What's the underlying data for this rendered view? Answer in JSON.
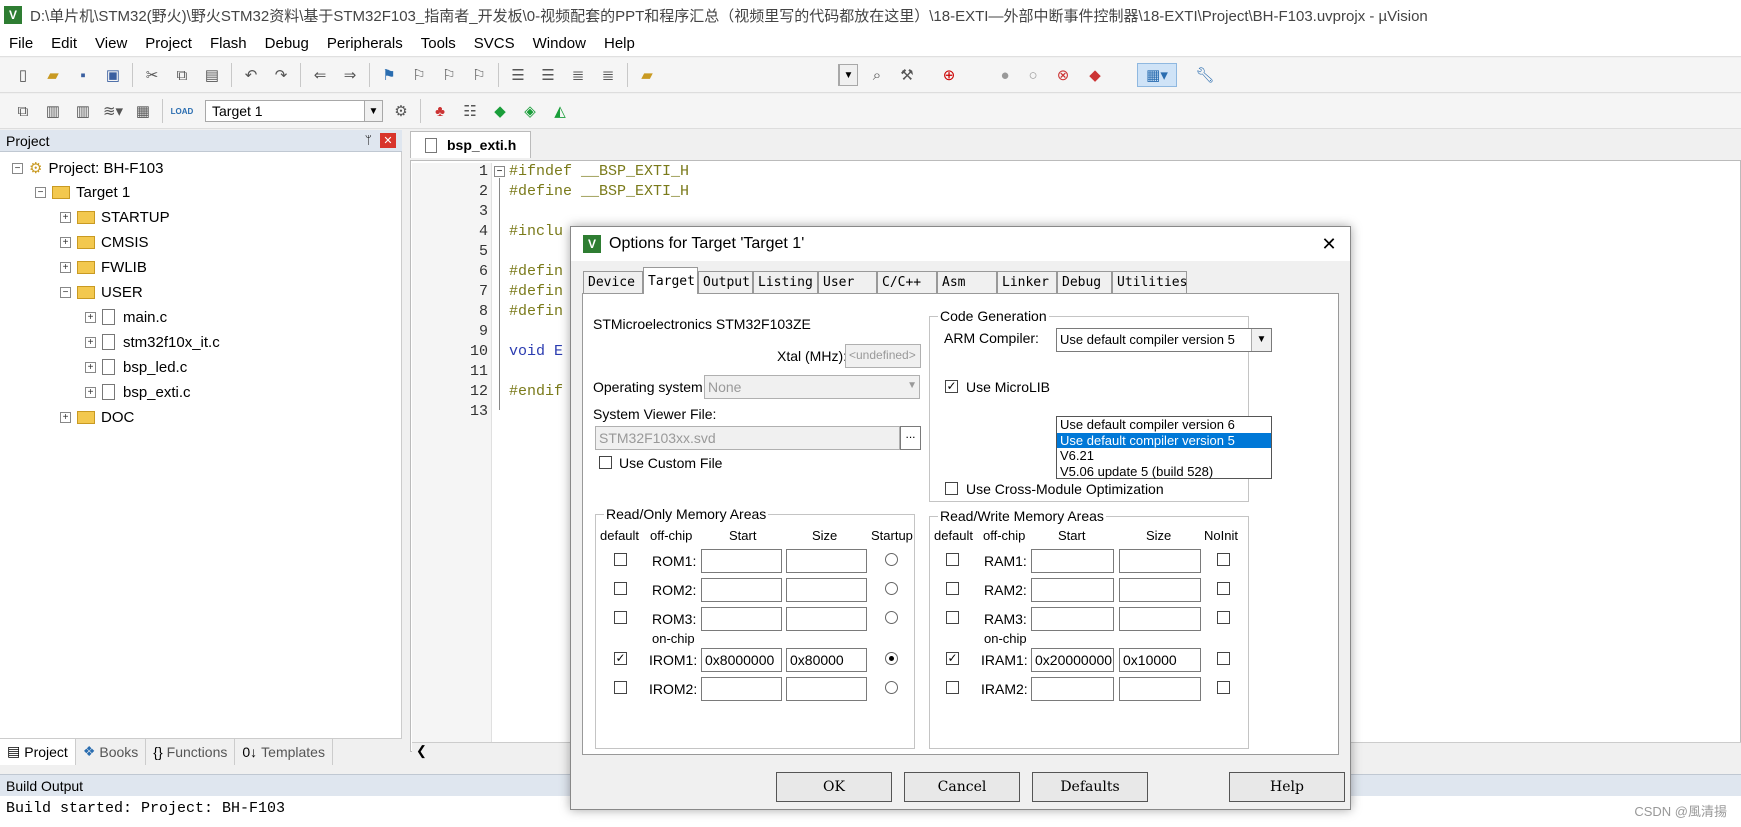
{
  "window": {
    "title": "D:\\单片机\\STM32(野火)\\野火STM32资料\\基于STM32F103_指南者_开发板\\0-视频配套的PPT和程序汇总（视频里写的代码都放在这里）\\18-EXTI—外部中断事件控制器\\18-EXTI\\Project\\BH-F103.uvprojx - µVision",
    "icon_letter": "V"
  },
  "menu": [
    "File",
    "Edit",
    "View",
    "Project",
    "Flash",
    "Debug",
    "Peripherals",
    "Tools",
    "SVCS",
    "Window",
    "Help"
  ],
  "toolbar2": {
    "target_combo": "Target 1",
    "load_icon_text": "LOAD"
  },
  "project_panel": {
    "header": "Project",
    "pin": "ᛘ",
    "close": "✕",
    "root": "Project: BH-F103",
    "target": "Target 1",
    "groups": [
      "STARTUP",
      "CMSIS",
      "FWLIB",
      "USER",
      "DOC"
    ],
    "user_files": [
      "main.c",
      "stm32f10x_it.c",
      "bsp_led.c",
      "bsp_exti.c"
    ],
    "tabs": [
      "Project",
      "Books",
      "Functions",
      "Templates"
    ]
  },
  "editor": {
    "tab": "bsp_exti.h",
    "lines": [
      {
        "n": "1",
        "t": "#ifndef __BSP_EXTI_H"
      },
      {
        "n": "2",
        "t": "#define __BSP_EXTI_H"
      },
      {
        "n": "3",
        "t": ""
      },
      {
        "n": "4",
        "t": "#inclu"
      },
      {
        "n": "5",
        "t": ""
      },
      {
        "n": "6",
        "t": "#defin"
      },
      {
        "n": "7",
        "t": "#defin"
      },
      {
        "n": "8",
        "t": "#defin"
      },
      {
        "n": "9",
        "t": ""
      },
      {
        "n": "10",
        "t": "void E"
      },
      {
        "n": "11",
        "t": ""
      },
      {
        "n": "12",
        "t": "#endif"
      },
      {
        "n": "13",
        "t": ""
      }
    ]
  },
  "build_output": {
    "header": "Build Output",
    "line": "Build started: Project: BH-F103"
  },
  "watermark": "CSDN @風清揚",
  "dialog": {
    "title": "Options for Target 'Target 1'",
    "close": "✕",
    "tabs": [
      "Device",
      "Target",
      "Output",
      "Listing",
      "User",
      "C/C++",
      "Asm",
      "Linker",
      "Debug",
      "Utilities"
    ],
    "active_tab": "Target",
    "device": "STMicroelectronics STM32F103ZE",
    "xtal_label": "Xtal (MHz):",
    "xtal_value": "<undefined>",
    "os_label": "Operating system:",
    "os_value": "None",
    "svf_label": "System Viewer File:",
    "svf_value": "STM32F103xx.svd",
    "browse": "...",
    "custom_file": "Use Custom File",
    "codegen": {
      "title": "Code Generation",
      "compiler_label": "ARM Compiler:",
      "compiler_value": "Use default compiler version 5",
      "options": [
        "Use default compiler version 6",
        "Use default compiler version 5",
        "V6.21",
        "V5.06 update 5 (build 528)"
      ],
      "microlib": "Use MicroLIB",
      "cross": "Use Cross-Module Optimization"
    },
    "rom": {
      "title": "Read/Only Memory Areas",
      "headers": [
        "default",
        "off-chip",
        "Start",
        "Size",
        "Startup"
      ],
      "rows": [
        {
          "name": "ROM1:",
          "start": "",
          "size": "",
          "def": false,
          "startup": false
        },
        {
          "name": "ROM2:",
          "start": "",
          "size": "",
          "def": false,
          "startup": false
        },
        {
          "name": "ROM3:",
          "start": "",
          "size": "",
          "def": false,
          "startup": false
        },
        {
          "name": "IROM1:",
          "start": "0x8000000",
          "size": "0x80000",
          "def": true,
          "startup": true
        },
        {
          "name": "IROM2:",
          "start": "",
          "size": "",
          "def": false,
          "startup": false
        }
      ],
      "onchip": "on-chip"
    },
    "ram": {
      "title": "Read/Write Memory Areas",
      "headers": [
        "default",
        "off-chip",
        "Start",
        "Size",
        "NoInit"
      ],
      "rows": [
        {
          "name": "RAM1:",
          "start": "",
          "size": ""
        },
        {
          "name": "RAM2:",
          "start": "",
          "size": ""
        },
        {
          "name": "RAM3:",
          "start": "",
          "size": ""
        },
        {
          "name": "IRAM1:",
          "start": "0x20000000",
          "size": "0x10000"
        },
        {
          "name": "IRAM2:",
          "start": "",
          "size": ""
        }
      ],
      "onchip": "on-chip"
    },
    "buttons": [
      "OK",
      "Cancel",
      "Defaults",
      "Help"
    ]
  }
}
